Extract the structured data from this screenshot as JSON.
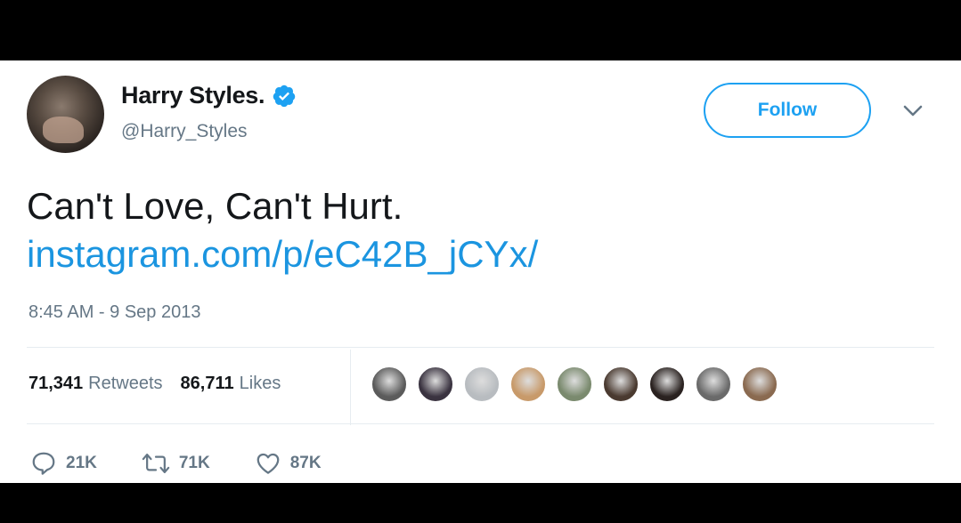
{
  "tweet": {
    "author_name": "Harry Styles.",
    "handle": "@Harry_Styles",
    "follow_label": "Follow",
    "text": "Can't Love, Can't Hurt.",
    "link": "instagram.com/p/eC42B_jCYx/",
    "timestamp": "8:45 AM - 9 Sep 2013"
  },
  "stats": {
    "retweets_count": "71,341",
    "retweets_label": "Retweets",
    "likes_count": "86,711",
    "likes_label": "Likes"
  },
  "likers": [
    {
      "color": "#5b5b5b"
    },
    {
      "color": "#3a3340"
    },
    {
      "color": "#b8bcc0"
    },
    {
      "color": "#c89a6a"
    },
    {
      "color": "#7a8a6e"
    },
    {
      "color": "#4a3a30"
    },
    {
      "color": "#2a2220"
    },
    {
      "color": "#6a6a6a"
    },
    {
      "color": "#8a6a50"
    }
  ],
  "actions": {
    "reply_count": "21K",
    "retweet_count": "71K",
    "like_count": "87K"
  },
  "colors": {
    "accent": "#1da1f2",
    "link": "#1b95e0",
    "muted": "#657786"
  }
}
